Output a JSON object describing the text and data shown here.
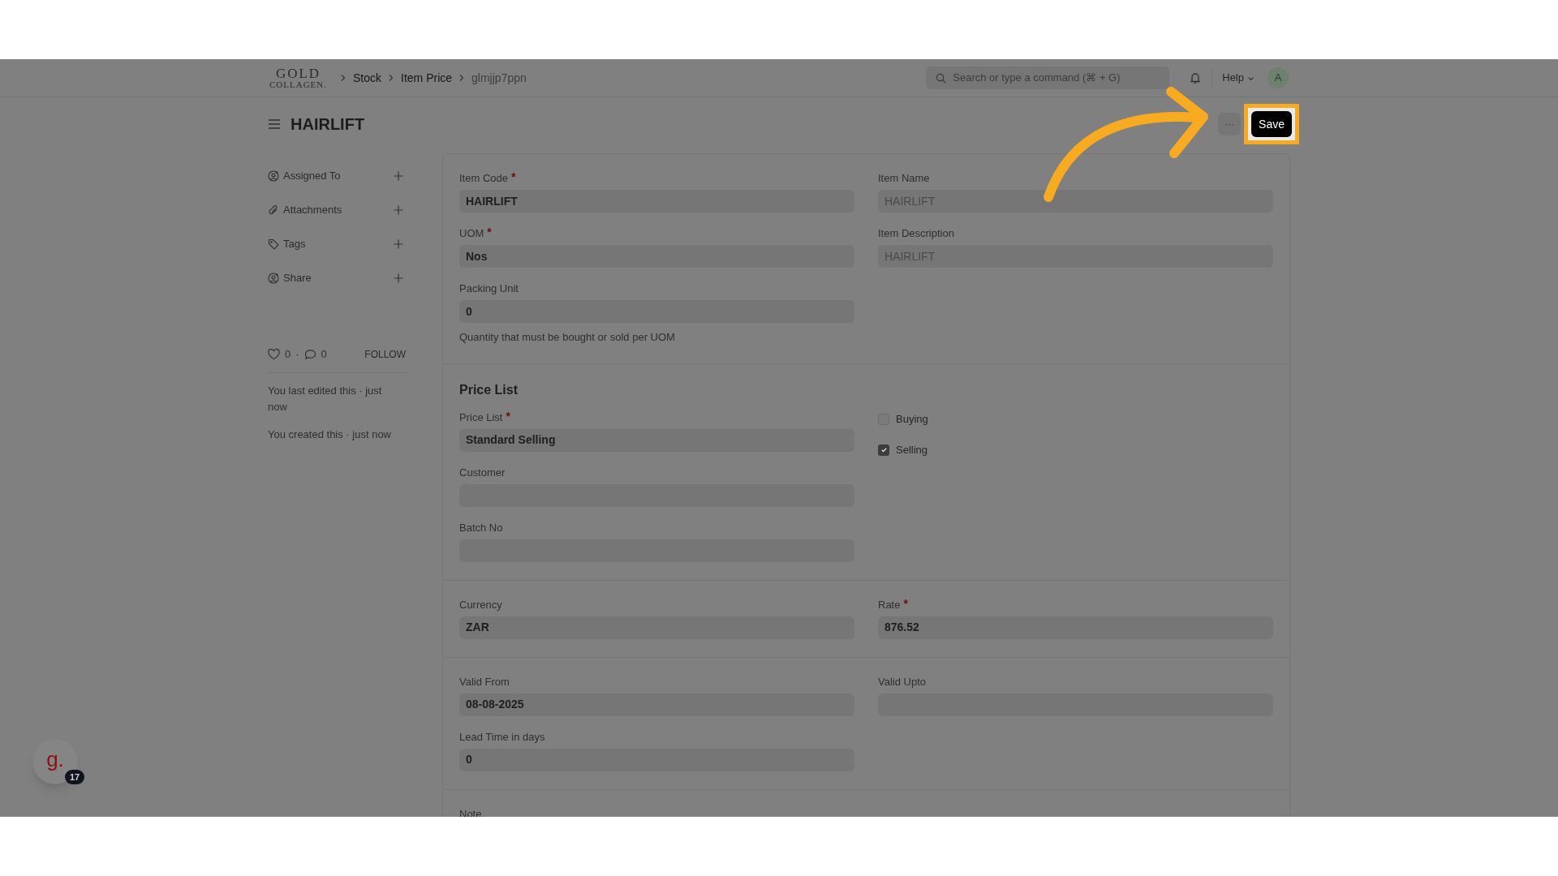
{
  "logo": {
    "line_1": "GOLD",
    "line_2": "COLLAGEN."
  },
  "breadcrumbs": [
    {
      "label": "Stock",
      "current": false
    },
    {
      "label": "Item Price",
      "current": false
    },
    {
      "label": "glmjjp7ppn",
      "current": true
    }
  ],
  "search": {
    "placeholder": "Search or type a command (⌘ + G)"
  },
  "help_menu": "Help",
  "avatar": "A",
  "title": "HAIRLIFT",
  "more_button": "···",
  "save_button": "Save",
  "sidebar": {
    "items": [
      {
        "label": "Assigned To",
        "kind": "assign"
      },
      {
        "label": "Attachments",
        "kind": "attach"
      },
      {
        "label": "Tags",
        "kind": "tag"
      },
      {
        "label": "Share",
        "kind": "share"
      }
    ],
    "likes": "0",
    "separator": "·",
    "comments": "0",
    "follow": "FOLLOW",
    "activity": [
      "You last edited this · just now",
      "You created this · just now"
    ]
  },
  "sections": [
    {
      "left": [
        {
          "kind": "input",
          "label": "Item Code",
          "required_mark": "*",
          "value": "HAIRLIFT"
        },
        {
          "kind": "input",
          "label": "UOM",
          "required_mark": "*",
          "value": "Nos"
        },
        {
          "kind": "input",
          "label": "Packing Unit",
          "value": "0",
          "description": "Quantity that must be bought or sold per UOM"
        }
      ],
      "right": [
        {
          "kind": "input",
          "label": "Item Name",
          "value": "HAIRLIFT",
          "read_only": true
        },
        {
          "kind": "input",
          "label": "Item Description",
          "value": "HAIRLIFT",
          "read_only": true
        }
      ]
    },
    {
      "title": "Price List",
      "left": [
        {
          "kind": "input",
          "label": "Price List",
          "required_mark": "*",
          "value": "Standard Selling"
        },
        {
          "kind": "input",
          "label": "Customer"
        },
        {
          "kind": "input",
          "label": "Batch No"
        }
      ],
      "right": [
        {
          "kind": "checkbox",
          "label": "Buying",
          "checked": false
        },
        {
          "kind": "checkbox",
          "label": "Selling",
          "checked": true
        }
      ]
    },
    {
      "left": [
        {
          "kind": "input",
          "label": "Currency",
          "value": "ZAR"
        }
      ],
      "right": [
        {
          "kind": "input",
          "label": "Rate",
          "required_mark": "*",
          "value": "876.52"
        }
      ]
    },
    {
      "left": [
        {
          "kind": "input",
          "label": "Valid From",
          "value": "08-08-2025"
        },
        {
          "kind": "input",
          "label": "Lead Time in days",
          "value": "0"
        }
      ],
      "right": [
        {
          "kind": "input",
          "label": "Valid Upto"
        }
      ]
    },
    {
      "left": [
        {
          "kind": "label",
          "label": "Note"
        }
      ]
    }
  ],
  "help_widget": {
    "letter": "g.",
    "count": "17"
  }
}
